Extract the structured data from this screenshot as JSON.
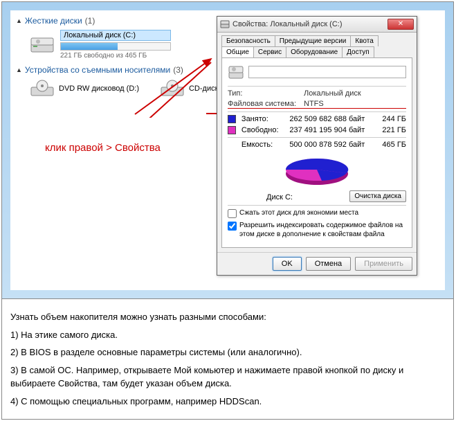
{
  "explorer": {
    "hard_drives_label": "Жесткие диски",
    "hard_drives_count": "(1)",
    "removable_label": "Устройства со съемными носителями",
    "removable_count": "(3)",
    "local_disk": {
      "name": "Локальный диск (C:)",
      "free": "221 ГБ свободно из 465 ГБ",
      "fill_percent": 52
    },
    "dvd": "DVD RW дисковод (D:)",
    "cd": "CD-дисковод"
  },
  "annotation": "клик правой > Свойства",
  "dialog": {
    "title": "Свойства: Локальный диск (C:)",
    "tabs_row1": [
      "Безопасность",
      "Предыдущие версии",
      "Квота"
    ],
    "tabs_row2": [
      "Общие",
      "Сервис",
      "Оборудование",
      "Доступ"
    ],
    "active_tab": "Общие",
    "name_value": "",
    "type_label": "Тип:",
    "type_value": "Локальный диск",
    "fs_label": "Файловая система:",
    "fs_value": "NTFS",
    "used_label": "Занято:",
    "used_bytes": "262 509 682 688 байт",
    "used_gb": "244 ГБ",
    "free_label": "Свободно:",
    "free_bytes": "237 491 195 904 байт",
    "free_gb": "221 ГБ",
    "cap_label": "Емкость:",
    "cap_bytes": "500 000 878 592 байт",
    "cap_gb": "465 ГБ",
    "pie_label": "Диск C:",
    "cleanup_btn": "Очистка диска",
    "compress": "Сжать этот диск для экономии места",
    "index": "Разрешить индексировать содержимое файлов на этом диске в дополнение к свойствам файла",
    "ok": "OK",
    "cancel": "Отмена",
    "apply": "Применить"
  },
  "article": {
    "p0": "Узнать объем накопителя можно узнать разными способами:",
    "p1": "1) На этике самого диска.",
    "p2": "2) В BIOS в разделе основные параметры системы (или аналогично).",
    "p3": "3) В самой ОС. Например, открываете Мой комьютер и нажимаете правой кнопкой по диску и выбираете Свойства, там будет указан объем диска.",
    "p4": "4) С помощью специальных программ, например HDDScan."
  },
  "chart_data": {
    "type": "pie",
    "title": "Диск C:",
    "series": [
      {
        "name": "Занято",
        "value": 262509682688,
        "gb": 244,
        "color": "#2020d0"
      },
      {
        "name": "Свободно",
        "value": 237491195904,
        "gb": 221,
        "color": "#e030c0"
      }
    ],
    "total": {
      "bytes": 500000878592,
      "gb": 465
    }
  }
}
